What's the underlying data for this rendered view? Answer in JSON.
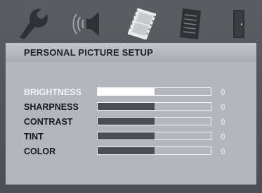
{
  "menu": {
    "icons": [
      {
        "name": "wrench-icon"
      },
      {
        "name": "speaker-icon"
      },
      {
        "name": "film-icon"
      },
      {
        "name": "document-icon"
      },
      {
        "name": "door-icon"
      }
    ],
    "active_icon": "film-icon"
  },
  "title": "PERSONAL PICTURE SETUP",
  "settings": [
    {
      "label": "BRIGHTNESS",
      "value": "0",
      "level": 0.5,
      "selected": true
    },
    {
      "label": "SHARPNESS",
      "value": "0",
      "level": 0.5,
      "selected": false
    },
    {
      "label": "CONTRAST",
      "value": "0",
      "level": 0.5,
      "selected": false
    },
    {
      "label": "TINT",
      "value": "0",
      "level": 0.5,
      "selected": false
    },
    {
      "label": "COLOR",
      "value": "0",
      "level": 0.5,
      "selected": false
    }
  ],
  "colors": {
    "background": "#4f5256",
    "panel": "#b3b6ba",
    "title_bar": "#b5b8bc",
    "bar_fill": "#4a4d51",
    "selected_fill": "#ffffff",
    "selected_text": "#f2f3f4"
  }
}
